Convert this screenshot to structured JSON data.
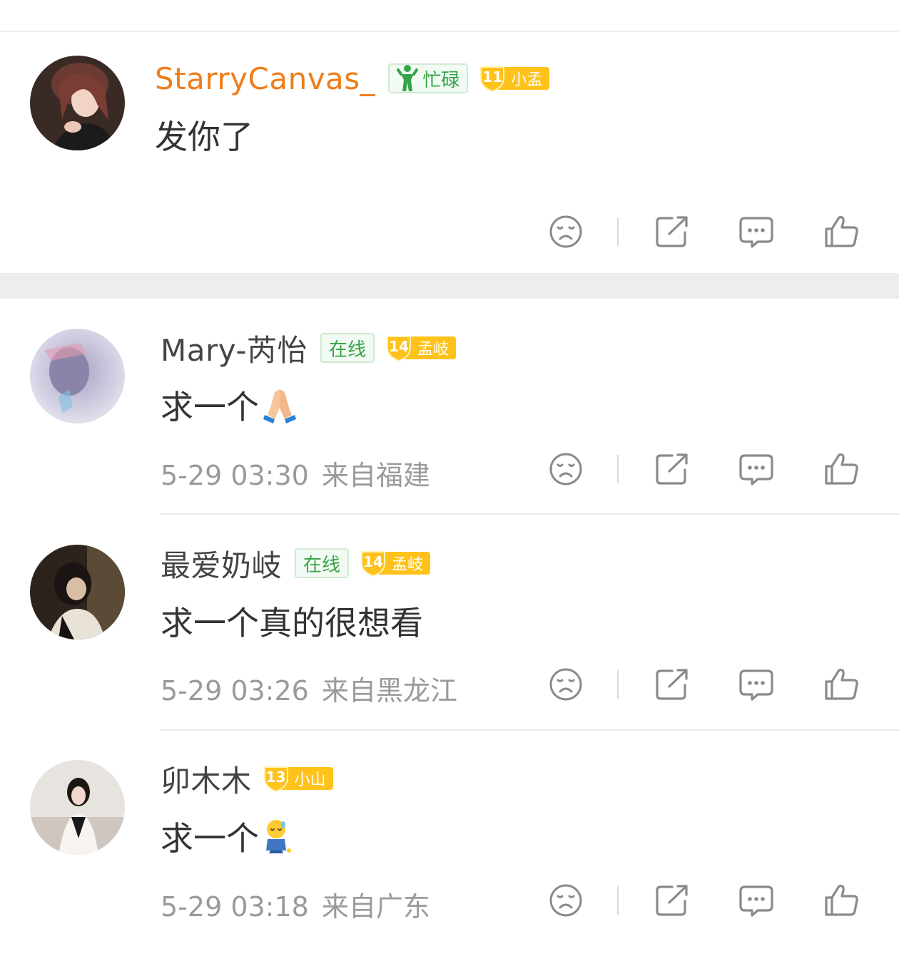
{
  "comments": [
    {
      "username": "StarryCanvas_",
      "status": "忙碌",
      "level": {
        "num": "11",
        "tag": "小孟"
      },
      "text": "发你了",
      "time": "",
      "location": ""
    },
    {
      "username": "Mary-芮怡",
      "status": "在线",
      "level": {
        "num": "14",
        "tag": "孟岐"
      },
      "text": "求一个",
      "emoji": "folded-hands-emoji",
      "time": "5-29 03:30",
      "location": "来自福建"
    },
    {
      "username": "最爱奶岐",
      "status": "在线",
      "level": {
        "num": "14",
        "tag": "孟岐"
      },
      "text": "求一个真的很想看",
      "time": "5-29 03:26",
      "location": "来自黑龙江"
    },
    {
      "username": "卯木木",
      "status": "",
      "level": {
        "num": "13",
        "tag": "小山"
      },
      "text": "求一个",
      "emoji": "praying-sweat-emoji",
      "time": "5-29 03:18",
      "location": "来自广东"
    }
  ],
  "icons": {
    "dislike": "dislike-face-icon",
    "share": "share-icon",
    "reply": "comment-icon",
    "like": "thumbs-up-icon"
  },
  "colors": {
    "username_highlight": "#f07d1a",
    "online_green": "#35a447",
    "level_gold": "#ffc21a",
    "icon_gray": "#8a8a8a"
  }
}
